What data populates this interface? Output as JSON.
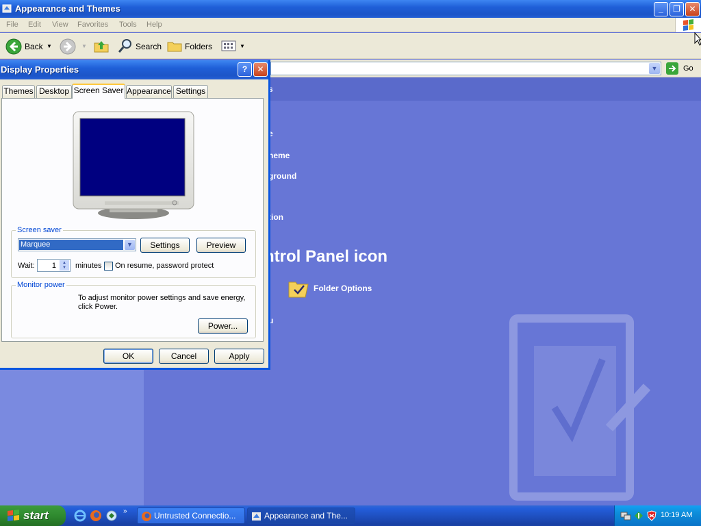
{
  "explorer": {
    "title": "Appearance and Themes",
    "menu": [
      "File",
      "Edit",
      "View",
      "Favorites",
      "Tools",
      "Help"
    ],
    "toolbar": {
      "back": "Back",
      "search": "Search",
      "folders": "Folders"
    },
    "go_label": "Go",
    "content": {
      "heading_partial": "s",
      "task_1_partial": "e",
      "task_2_partial": "heme",
      "task_3_partial": "ground",
      "task_4_partial": "tion",
      "section_partial": "ntrol Panel icon",
      "folder_options": "Folder Options",
      "bottom_partial": "u"
    }
  },
  "dialog": {
    "title": "Display Properties",
    "tabs": [
      "Themes",
      "Desktop",
      "Screen Saver",
      "Appearance",
      "Settings"
    ],
    "active_tab": "Screen Saver",
    "screensaver": {
      "group_label": "Screen saver",
      "selected": "Marquee",
      "settings_button": "Settings",
      "preview_button": "Preview",
      "wait_label": "Wait:",
      "wait_value": "1",
      "minutes_label": "minutes",
      "password_label": "On resume, password protect"
    },
    "monitor": {
      "group_label": "Monitor power",
      "description_line1": "To adjust monitor power settings and save energy,",
      "description_line2": "click Power.",
      "power_button": "Power..."
    },
    "buttons": {
      "ok": "OK",
      "cancel": "Cancel",
      "apply": "Apply"
    }
  },
  "taskbar": {
    "start": "start",
    "items": [
      "Untrusted Connectio...",
      "Appearance and The..."
    ],
    "clock": "10:19 AM"
  },
  "colors": {
    "titlebar": "#1f5fd8",
    "content_bg": "#6776d6",
    "screen_preview": "#000080",
    "start_green": "#2f8a2f"
  }
}
